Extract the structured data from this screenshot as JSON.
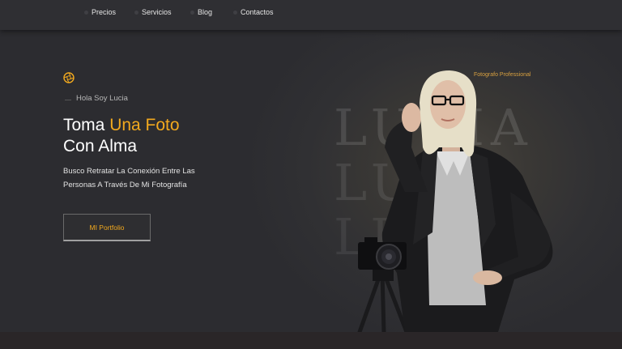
{
  "nav": {
    "items": [
      {
        "label": "Precios"
      },
      {
        "label": "Servicios"
      },
      {
        "label": "Blog"
      },
      {
        "label": "Contactos"
      }
    ]
  },
  "hero": {
    "kicker": "Hola Soy Lucia",
    "title_line1_plain": "Toma ",
    "title_line1_accent": "Una Foto",
    "title_line2": "Con Alma",
    "description": "Busco Retratar La Conexión Entre Las Personas A Través De Mi Fotografía",
    "button_label": "MI Portfolio",
    "role_label": "Fotografo Professional",
    "background_name": [
      "LUCIA",
      "LUCIA",
      "LUCIA"
    ]
  },
  "colors": {
    "accent": "#f2a91e",
    "background": "#2c2c30"
  },
  "icons": {
    "logo": "aperture-icon",
    "photo": "photographer-portrait-image"
  }
}
